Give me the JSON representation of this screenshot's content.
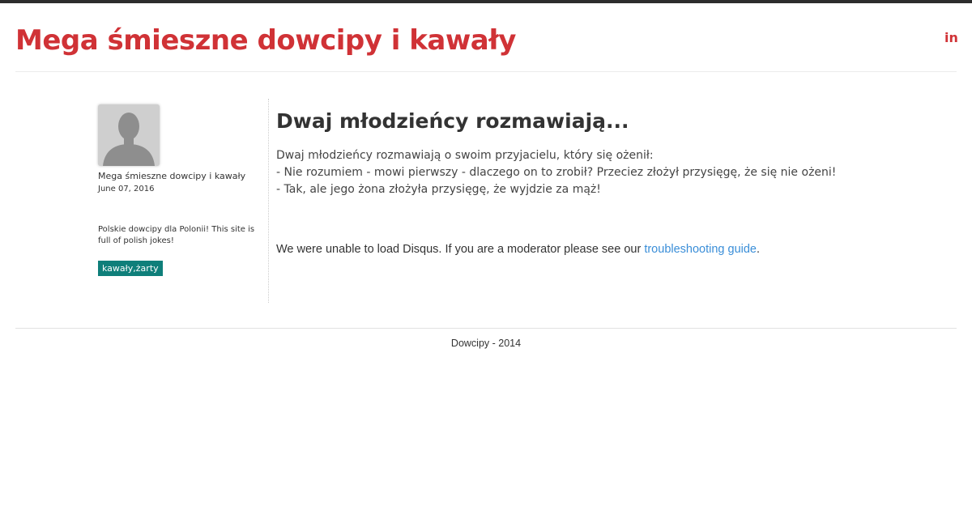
{
  "header": {
    "site_title": "Mega śmieszne dowcipy i kawały",
    "social_label": "in",
    "social_icon": "linkedin-icon",
    "accent_color": "#d03236"
  },
  "sidebar": {
    "avatar_icon": "user-silhouette-icon",
    "author": "Mega śmieszne dowcipy i kawały",
    "date": "June 07, 2016",
    "blurb": "Polskie dowcipy dla Polonii! This site is full of polish jokes!",
    "tag": "kawały,żarty",
    "tag_color": "#0f7f7a"
  },
  "post": {
    "title": "Dwaj młodzieńcy rozmawiają...",
    "lines": [
      "Dwaj młodzieńcy rozmawiają o swoim przyjacielu, który się ożenił:",
      "- Nie rozumiem - mowi pierwszy - dlaczego on to zrobił? Przeciez złożył przysięgę, że się nie ożeni!",
      "- Tak, ale jego żona złożyła przysięgę, że wyjdzie za mąż!"
    ]
  },
  "disqus": {
    "message": "We were unable to load Disqus. If you are a moderator please see our ",
    "link_text": "troubleshooting guide",
    "suffix": "."
  },
  "footer": {
    "text": "Dowcipy - 2014"
  }
}
